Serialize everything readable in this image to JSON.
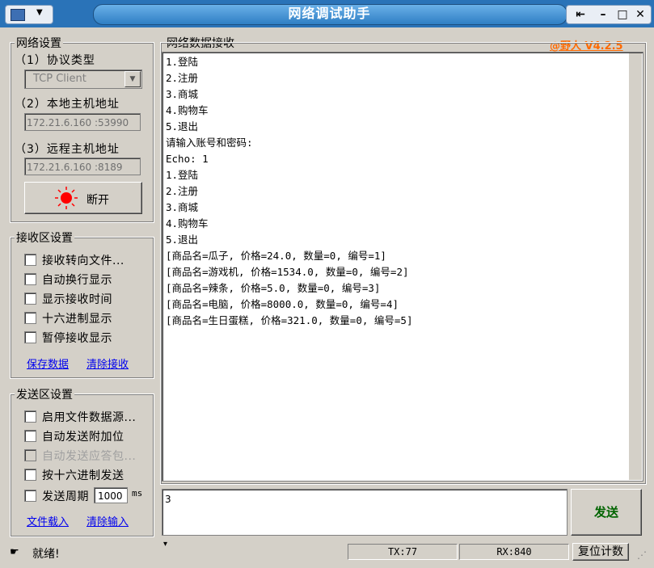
{
  "window": {
    "title": "网络调试助手",
    "brand": "@野人 V4.2.5"
  },
  "net_settings": {
    "legend": "网络设置",
    "protocol_label": "（1）协议类型",
    "protocol_value": "TCP Client",
    "local_label": "（2）本地主机地址",
    "local_value": "172.21.6.160 :53990",
    "remote_label": "（3）远程主机地址",
    "remote_value": "172.21.6.160 :8189",
    "disconnect_label": "断开"
  },
  "recv_settings": {
    "legend": "接收区设置",
    "options": [
      {
        "label": "接收转向文件...",
        "checked": false,
        "disabled": false
      },
      {
        "label": "自动换行显示",
        "checked": false,
        "disabled": false
      },
      {
        "label": "显示接收时间",
        "checked": false,
        "disabled": false
      },
      {
        "label": "十六进制显示",
        "checked": false,
        "disabled": false
      },
      {
        "label": "暂停接收显示",
        "checked": false,
        "disabled": false
      }
    ],
    "save_link": "保存数据",
    "clear_link": "清除接收"
  },
  "send_settings": {
    "legend": "发送区设置",
    "options": [
      {
        "label": "启用文件数据源...",
        "checked": false,
        "disabled": false
      },
      {
        "label": "自动发送附加位",
        "checked": false,
        "disabled": false
      },
      {
        "label": "自动发送应答包...",
        "checked": false,
        "disabled": true
      },
      {
        "label": "按十六进制发送",
        "checked": false,
        "disabled": false
      },
      {
        "label": "发送周期",
        "checked": false,
        "disabled": false
      }
    ],
    "period_value": "1000",
    "period_unit": "ms",
    "load_link": "文件载入",
    "clear_link": "清除输入"
  },
  "receive": {
    "legend": "网络数据接收",
    "lines": [
      "1.登陆",
      "2.注册",
      "3.商城",
      "4.购物车",
      "5.退出",
      "请输入账号和密码:",
      "Echo: 1",
      "1.登陆",
      "2.注册",
      "3.商城",
      "4.购物车",
      "5.退出",
      "[商品名=瓜子, 价格=24.0, 数量=0, 编号=1]",
      "[商品名=游戏机, 价格=1534.0, 数量=0, 编号=2]",
      "[商品名=辣条, 价格=5.0, 数量=0, 编号=3]",
      "[商品名=电脑, 价格=8000.0, 数量=0, 编号=4]",
      "[商品名=生日蛋糕, 价格=321.0, 数量=0, 编号=5]"
    ]
  },
  "send": {
    "input_value": "3",
    "send_label": "发送"
  },
  "status": {
    "text": "就绪!",
    "tx": "TX:77",
    "rx": "RX:840",
    "reset_label": "复位计数"
  },
  "colors": {
    "titlebar": "#2a73b8",
    "brand": "#ff6a00",
    "link": "#0000ee",
    "disconnect_indicator": "#ff0000"
  }
}
